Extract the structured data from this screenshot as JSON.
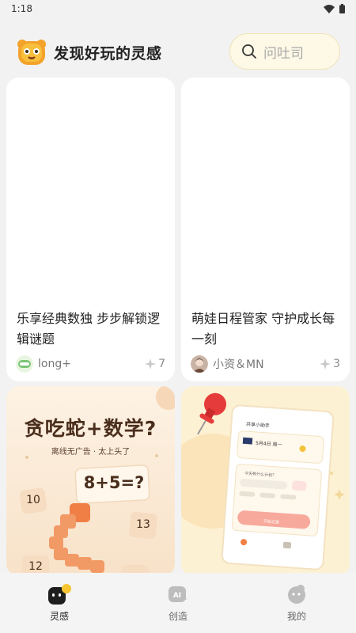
{
  "status": {
    "time": "1:18"
  },
  "header": {
    "title": "发现好玩的灵感",
    "search_placeholder": "问吐司"
  },
  "cards": [
    {
      "title": "乐享经典数独 步步解锁逻辑谜题",
      "author": "long+",
      "likes": "7"
    },
    {
      "title": "萌娃日程管家 守护成长每一刻",
      "author": "小资＆MN",
      "likes": "3"
    }
  ],
  "promo_snake": {
    "headline": "贪吃蛇+数学?",
    "subline": "离线无广告 · 太上头了",
    "equation": "8+5=?",
    "tiles": [
      "10",
      "13",
      "12"
    ]
  },
  "promo_planner": {
    "app_name": "共享小助手",
    "summary": "5月4日 周一",
    "sections": [
      "今天有什么计划？",
      "开始记录"
    ]
  },
  "tabs": [
    {
      "label": "灵感",
      "active": true
    },
    {
      "label": "创造",
      "active": false
    },
    {
      "label": "我的",
      "active": false
    }
  ]
}
